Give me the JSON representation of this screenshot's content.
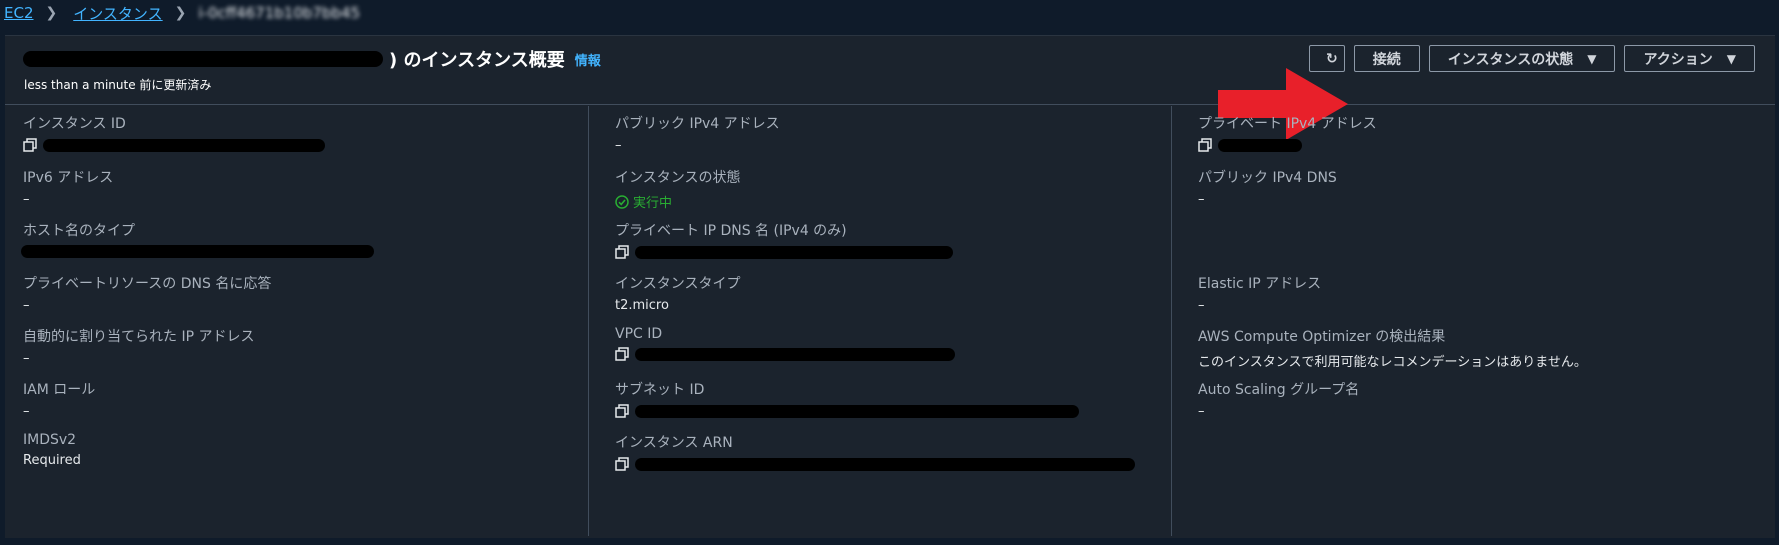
{
  "breadcrumb": {
    "root": "EC2",
    "section": "インスタンス",
    "current": "i-0cff4671b10b7bb45"
  },
  "header": {
    "title_suffix": ") のインスタンス概要",
    "info": "情報",
    "subtitle": "less than a minute 前に更新済み"
  },
  "actions": {
    "connect": "接続",
    "instance_state": "インスタンスの状態",
    "actions": "アクション"
  },
  "details": {
    "instance_id": {
      "label": "インスタンス ID"
    },
    "ipv6": {
      "label": "IPv6 アドレス",
      "value": "–"
    },
    "hostname_type": {
      "label": "ホスト名のタイプ"
    },
    "private_dns_answer": {
      "label": "プライベートリソースの DNS 名に応答",
      "value": "–"
    },
    "auto_ip": {
      "label": "自動的に割り当てられた IP アドレス",
      "value": "–"
    },
    "iam_role": {
      "label": "IAM ロール",
      "value": "–"
    },
    "imdsv2": {
      "label": "IMDSv2",
      "value": "Required"
    },
    "public_ipv4": {
      "label": "パブリック IPv4 アドレス",
      "value": "–"
    },
    "instance_state": {
      "label": "インスタンスの状態",
      "value": "実行中"
    },
    "private_ip_dns": {
      "label": "プライベート IP DNS 名 (IPv4 のみ)"
    },
    "instance_type": {
      "label": "インスタンスタイプ",
      "value": "t2.micro"
    },
    "vpc_id": {
      "label": "VPC ID"
    },
    "subnet_id": {
      "label": "サブネット ID"
    },
    "instance_arn": {
      "label": "インスタンス ARN"
    },
    "private_ipv4": {
      "label": "プライベート IPv4 アドレス"
    },
    "public_ipv4_dns": {
      "label": "パブリック IPv4 DNS",
      "value": "–"
    },
    "elastic_ip": {
      "label": "Elastic IP アドレス",
      "value": "–"
    },
    "optimizer": {
      "label": "AWS Compute Optimizer の検出結果",
      "value": "このインスタンスで利用可能なレコメンデーションはありません。"
    },
    "asg": {
      "label": "Auto Scaling グループ名",
      "value": "–"
    }
  },
  "colors": {
    "link": "#42b4ff",
    "running": "#29ad32",
    "arrow": "#e8202a",
    "panel": "#1b232d"
  }
}
